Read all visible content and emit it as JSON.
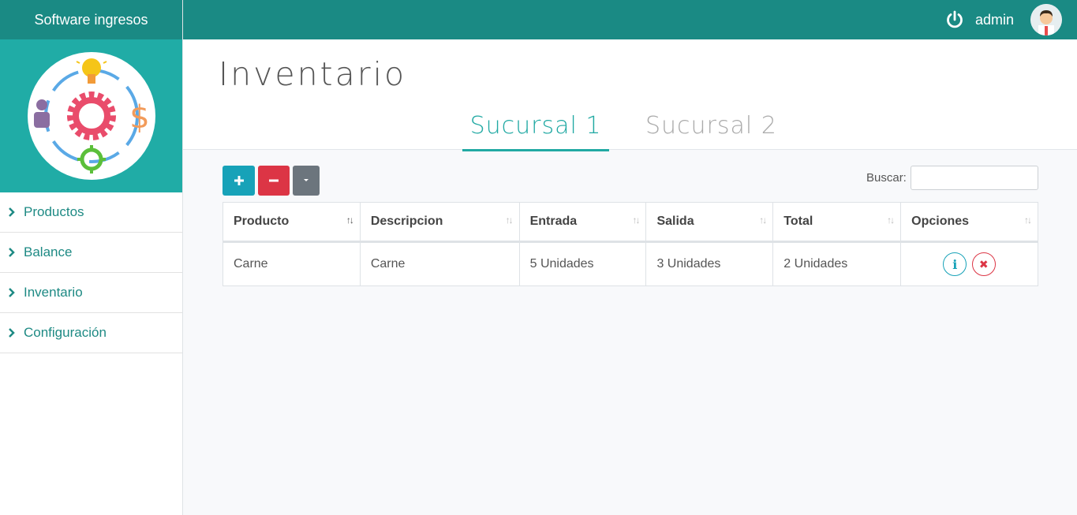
{
  "sidebar": {
    "brand": "Software ingresos",
    "logo_icon": "gear-dollar-lightbulb-logo",
    "items": [
      {
        "label": "Productos"
      },
      {
        "label": "Balance"
      },
      {
        "label": "Inventario"
      },
      {
        "label": "Configuración"
      }
    ]
  },
  "topbar": {
    "username": "admin",
    "power_icon": "power-icon",
    "avatar_icon": "user-avatar"
  },
  "page": {
    "title": "Inventario",
    "tabs": [
      {
        "label": "Sucursal 1",
        "active": true
      },
      {
        "label": "Sucursal 2",
        "active": false
      }
    ]
  },
  "toolbar": {
    "add_icon": "plus-icon",
    "remove_icon": "minus-icon",
    "more_icon": "caret-down-icon",
    "search_label": "Buscar:",
    "search_value": ""
  },
  "table": {
    "columns": [
      "Producto",
      "Descripcion",
      "Entrada",
      "Salida",
      "Total",
      "Opciones"
    ],
    "rows": [
      {
        "producto": "Carne",
        "descripcion": "Carne",
        "entrada": "5 Unidades",
        "salida": "3 Unidades",
        "total": "2 Unidades"
      }
    ],
    "options": {
      "info_glyph": "i",
      "delete_glyph": "✖"
    }
  },
  "colors": {
    "primary": "#1a8a84",
    "accent": "#21a9a3",
    "info": "#17a2b8",
    "danger": "#dc3545",
    "secondary": "#6c757d"
  }
}
